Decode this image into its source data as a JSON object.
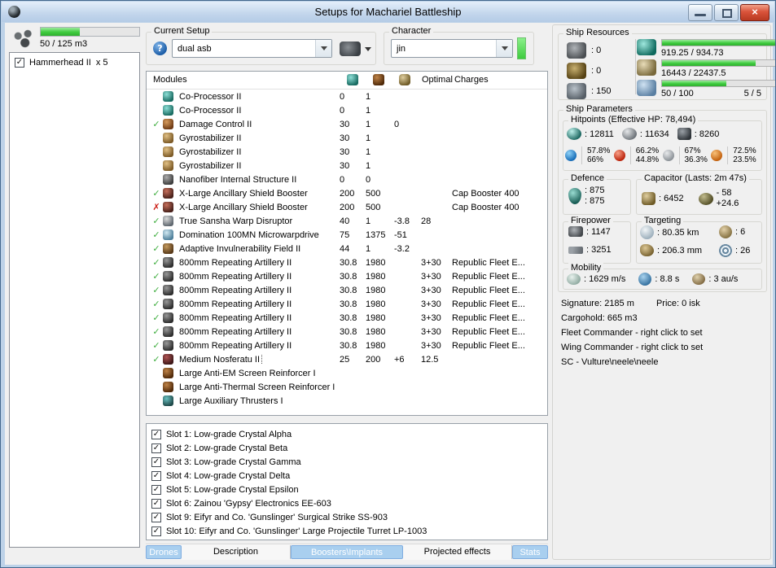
{
  "window": {
    "title": "Setups for Machariel Battleship"
  },
  "icons": {
    "check": "✓",
    "cross": "✗",
    "close": "×",
    "question": "?"
  },
  "colors": {
    "accent_green": "#3ecb3e",
    "tab_active_bg": "#a9cfef",
    "tab_active_border": "#7fade0"
  },
  "drone_bay": {
    "capacity_text": "50 / 125 m3",
    "fill_pct": 40,
    "items": [
      {
        "checked": true,
        "name": "Hammerhead II",
        "qty": "x 5"
      }
    ]
  },
  "current_setup": {
    "label": "Current Setup",
    "value": "dual asb"
  },
  "character": {
    "label": "Character",
    "value": "jin"
  },
  "ship_resources": {
    "label": "Ship Resources",
    "turret_slots": ": 0",
    "launcher_slots": ": 0",
    "rig_slots": ": 150",
    "cpu": {
      "text": "919.25 / 934.73",
      "pct": 98
    },
    "powergrid": {
      "text": "16443 / 22437.5",
      "pct": 73
    },
    "calibration": {
      "text": "50 / 100",
      "pct": 50,
      "right": "5 / 5"
    }
  },
  "modules": {
    "title": "Modules",
    "col_optimal": "Optimal",
    "col_charges": "Charges",
    "rows": [
      {
        "status": "",
        "icon": "cpu",
        "name": "Co-Processor II",
        "cpu": "0",
        "pg": "1",
        "cap": "",
        "optimal": "",
        "charges": ""
      },
      {
        "status": "",
        "icon": "cpu",
        "name": "Co-Processor II",
        "cpu": "0",
        "pg": "1",
        "cap": "",
        "optimal": "",
        "charges": ""
      },
      {
        "status": "ok",
        "icon": "damage-control",
        "name": "Damage Control II",
        "cpu": "30",
        "pg": "1",
        "cap": "0",
        "optimal": "",
        "charges": ""
      },
      {
        "status": "",
        "icon": "gyro",
        "name": "Gyrostabilizer II",
        "cpu": "30",
        "pg": "1",
        "cap": "",
        "optimal": "",
        "charges": ""
      },
      {
        "status": "",
        "icon": "gyro",
        "name": "Gyrostabilizer II",
        "cpu": "30",
        "pg": "1",
        "cap": "",
        "optimal": "",
        "charges": ""
      },
      {
        "status": "",
        "icon": "gyro",
        "name": "Gyrostabilizer II",
        "cpu": "30",
        "pg": "1",
        "cap": "",
        "optimal": "",
        "charges": ""
      },
      {
        "status": "",
        "icon": "nanofiber",
        "name": "Nanofiber Internal Structure II",
        "cpu": "0",
        "pg": "0",
        "cap": "",
        "optimal": "",
        "charges": ""
      },
      {
        "status": "ok",
        "icon": "shield-booster",
        "name": "X-Large Ancillary Shield Booster",
        "cpu": "200",
        "pg": "500",
        "cap": "",
        "optimal": "",
        "charges": "Cap Booster 400"
      },
      {
        "status": "off",
        "icon": "shield-booster",
        "name": "X-Large Ancillary Shield Booster",
        "cpu": "200",
        "pg": "500",
        "cap": "",
        "optimal": "",
        "charges": "Cap Booster 400"
      },
      {
        "status": "ok",
        "icon": "warp-disruptor",
        "name": "True Sansha Warp Disruptor",
        "cpu": "40",
        "pg": "1",
        "cap": "-3.8",
        "optimal": "28",
        "charges": ""
      },
      {
        "status": "ok",
        "icon": "mwd",
        "name": "Domination 100MN Microwarpdrive",
        "cpu": "75",
        "pg": "1375",
        "cap": "-51",
        "optimal": "",
        "charges": ""
      },
      {
        "status": "ok",
        "icon": "invuln",
        "name": "Adaptive Invulnerability Field II",
        "cpu": "44",
        "pg": "1",
        "cap": "-3.2",
        "optimal": "",
        "charges": ""
      },
      {
        "status": "ok",
        "icon": "artillery",
        "name": "800mm Repeating Artillery II",
        "cpu": "30.8",
        "pg": "1980",
        "cap": "",
        "optimal": "3+30",
        "charges": "Republic Fleet E..."
      },
      {
        "status": "ok",
        "icon": "artillery",
        "name": "800mm Repeating Artillery II",
        "cpu": "30.8",
        "pg": "1980",
        "cap": "",
        "optimal": "3+30",
        "charges": "Republic Fleet E..."
      },
      {
        "status": "ok",
        "icon": "artillery",
        "name": "800mm Repeating Artillery II",
        "cpu": "30.8",
        "pg": "1980",
        "cap": "",
        "optimal": "3+30",
        "charges": "Republic Fleet E..."
      },
      {
        "status": "ok",
        "icon": "artillery",
        "name": "800mm Repeating Artillery II",
        "cpu": "30.8",
        "pg": "1980",
        "cap": "",
        "optimal": "3+30",
        "charges": "Republic Fleet E..."
      },
      {
        "status": "ok",
        "icon": "artillery",
        "name": "800mm Repeating Artillery II",
        "cpu": "30.8",
        "pg": "1980",
        "cap": "",
        "optimal": "3+30",
        "charges": "Republic Fleet E..."
      },
      {
        "status": "ok",
        "icon": "artillery",
        "name": "800mm Repeating Artillery II",
        "cpu": "30.8",
        "pg": "1980",
        "cap": "",
        "optimal": "3+30",
        "charges": "Republic Fleet E..."
      },
      {
        "status": "ok",
        "icon": "artillery",
        "name": "800mm Repeating Artillery II",
        "cpu": "30.8",
        "pg": "1980",
        "cap": "",
        "optimal": "3+30",
        "charges": "Republic Fleet E..."
      },
      {
        "status": "ok",
        "icon": "nosferatu",
        "name": "Medium Nosferatu II",
        "cpu": "25",
        "pg": "200",
        "cap": "+6",
        "optimal": "12.5",
        "charges": "",
        "focused": true
      },
      {
        "status": "",
        "icon": "rig-em",
        "name": "Large Anti-EM Screen Reinforcer I",
        "cpu": "",
        "pg": "",
        "cap": "",
        "optimal": "",
        "charges": ""
      },
      {
        "status": "",
        "icon": "rig-thermal",
        "name": "Large Anti-Thermal Screen Reinforcer I",
        "cpu": "",
        "pg": "",
        "cap": "",
        "optimal": "",
        "charges": ""
      },
      {
        "status": "",
        "icon": "rig-thruster",
        "name": "Large Auxiliary Thrusters I",
        "cpu": "",
        "pg": "",
        "cap": "",
        "optimal": "",
        "charges": ""
      }
    ]
  },
  "implants": {
    "rows": [
      {
        "checked": true,
        "label": "Slot 1: Low-grade Crystal Alpha"
      },
      {
        "checked": true,
        "label": "Slot 2: Low-grade Crystal Beta"
      },
      {
        "checked": true,
        "label": "Slot 3: Low-grade Crystal Gamma"
      },
      {
        "checked": true,
        "label": "Slot 4: Low-grade Crystal Delta"
      },
      {
        "checked": true,
        "label": "Slot 5: Low-grade Crystal Epsilon"
      },
      {
        "checked": true,
        "label": "Slot 6: Zainou 'Gypsy' Electronics EE-603"
      },
      {
        "checked": true,
        "label": "Slot 9: Eifyr and Co. 'Gunslinger' Surgical Strike SS-903"
      },
      {
        "checked": true,
        "label": "Slot 10: Eifyr and Co. 'Gunslinger' Large Projectile Turret LP-1003"
      }
    ]
  },
  "tabs": [
    {
      "label": "Drones",
      "active": true
    },
    {
      "label": "Description",
      "active": false
    },
    {
      "label": "Boosters\\Implants",
      "active": true
    },
    {
      "label": "Projected effects",
      "active": false
    },
    {
      "label": "Stats",
      "active": true
    }
  ],
  "ship_parameters": {
    "label": "Ship Parameters",
    "hitpoints": {
      "label": "Hitpoints (Effective HP: 78,494)",
      "shield": ": 12811",
      "armor": ": 11634",
      "hull": ": 8260",
      "resists": [
        {
          "type": "em",
          "top": "57.8%",
          "bottom": "66%"
        },
        {
          "type": "thermal",
          "top": "66.2%",
          "bottom": "44.8%"
        },
        {
          "type": "kinetic",
          "top": "67%",
          "bottom": "36.3%"
        },
        {
          "type": "explosive",
          "top": "72.5%",
          "bottom": "23.5%"
        }
      ]
    },
    "defence": {
      "label": "Defence",
      "top": ": 875",
      "bottom": ": 875"
    },
    "capacitor": {
      "label": "Capacitor (Lasts: 2m 47s)",
      "amount": ": 6452",
      "delta_top": "- 58",
      "delta_bottom": "+24.6"
    },
    "firepower": {
      "label": "Firepower",
      "dps": ": 1147",
      "volley": ": 3251"
    },
    "targeting": {
      "label": "Targeting",
      "range": ": 80.35 km",
      "max_targets": ": 6",
      "scan_resolution": ": 206.3 mm",
      "sensor_strength": ": 26"
    },
    "mobility": {
      "label": "Mobility",
      "speed": ": 1629 m/s",
      "align_time": ": 8.8 s",
      "warp_speed": ": 3 au/s"
    }
  },
  "info": {
    "signature": "Signature: 2185 m",
    "price": "Price: 0 isk",
    "cargohold": "Cargohold: 665 m3",
    "fleet_commander": "Fleet Commander - right click to set",
    "wing_commander": "Wing Commander - right click to set",
    "sc": "SC - Vulture\\neele\\neele"
  }
}
